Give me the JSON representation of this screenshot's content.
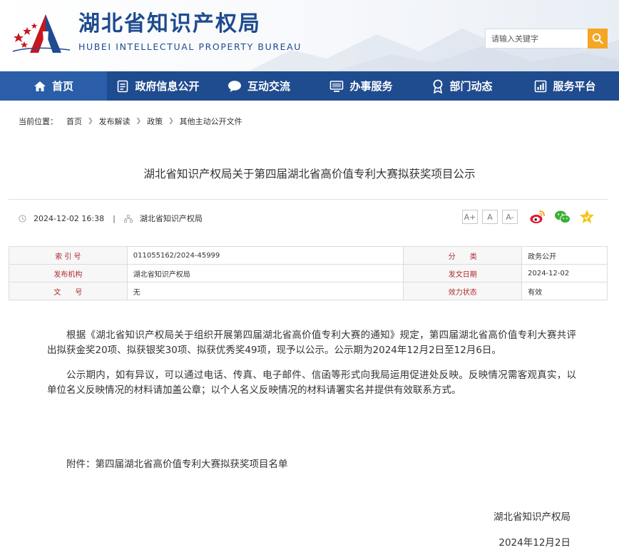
{
  "header": {
    "site_name": "湖北省知识产权局",
    "site_name_en": "HUBEI INTELLECTUAL PROPERTY BUREAU",
    "search_placeholder": "请输入关键字"
  },
  "nav": {
    "items": [
      {
        "label": "首页",
        "icon": "home-icon"
      },
      {
        "label": "政府信息公开",
        "icon": "document-list-icon"
      },
      {
        "label": "互动交流",
        "icon": "chat-bubble-icon"
      },
      {
        "label": "办事服务",
        "icon": "monitor-icon"
      },
      {
        "label": "部门动态",
        "icon": "award-icon"
      },
      {
        "label": "服务平台",
        "icon": "bar-chart-icon"
      }
    ]
  },
  "breadcrumb": {
    "prefix": "当前位置：",
    "items": [
      "首页",
      "发布解读",
      "政策",
      "其他主动公开文件"
    ]
  },
  "article": {
    "title": "湖北省知识产权局关于第四届湖北省高价值专利大赛拟获奖项目公示",
    "datetime": "2024-12-02 16:38",
    "source": "湖北省知识产权局",
    "font_sizes": [
      "A+",
      "A",
      "A-"
    ],
    "paragraphs": [
      "根据《湖北省知识产权局关于组织开展第四届湖北省高价值专利大赛的通知》规定，第四届湖北省高价值专利大赛共评出拟获金奖20项、拟获银奖30项、拟获优秀奖49项，现予以公示。公示期为2024年12月2日至12月6日。",
      "公示期内，如有异议，可以通过电话、传真、电子邮件、信函等形式向我局运用促进处反映。反映情况需客观真实，以单位名义反映情况的材料请加盖公章；以个人名义反映情况的材料请署实名并提供有效联系方式。"
    ],
    "attachment": "附件：第四届湖北省高价值专利大赛拟获奖项目名单",
    "signature": "湖北省知识产权局",
    "signature_date": "2024年12月2日"
  },
  "info_table": {
    "rows": [
      {
        "label1": "索 引 号",
        "value1": "011055162/2024-45999",
        "label2": "分　　类",
        "value2": "政务公开"
      },
      {
        "label1": "发布机构",
        "value1": "湖北省知识产权局",
        "label2": "发文日期",
        "value2": "2024-12-02"
      },
      {
        "label1": "文　　号",
        "value1": "无",
        "label2": "效力状态",
        "value2": "有效"
      }
    ]
  },
  "colors": {
    "brand_blue": "#1f4b8f",
    "accent_orange": "#f5a623",
    "label_red": "#b0282e"
  }
}
